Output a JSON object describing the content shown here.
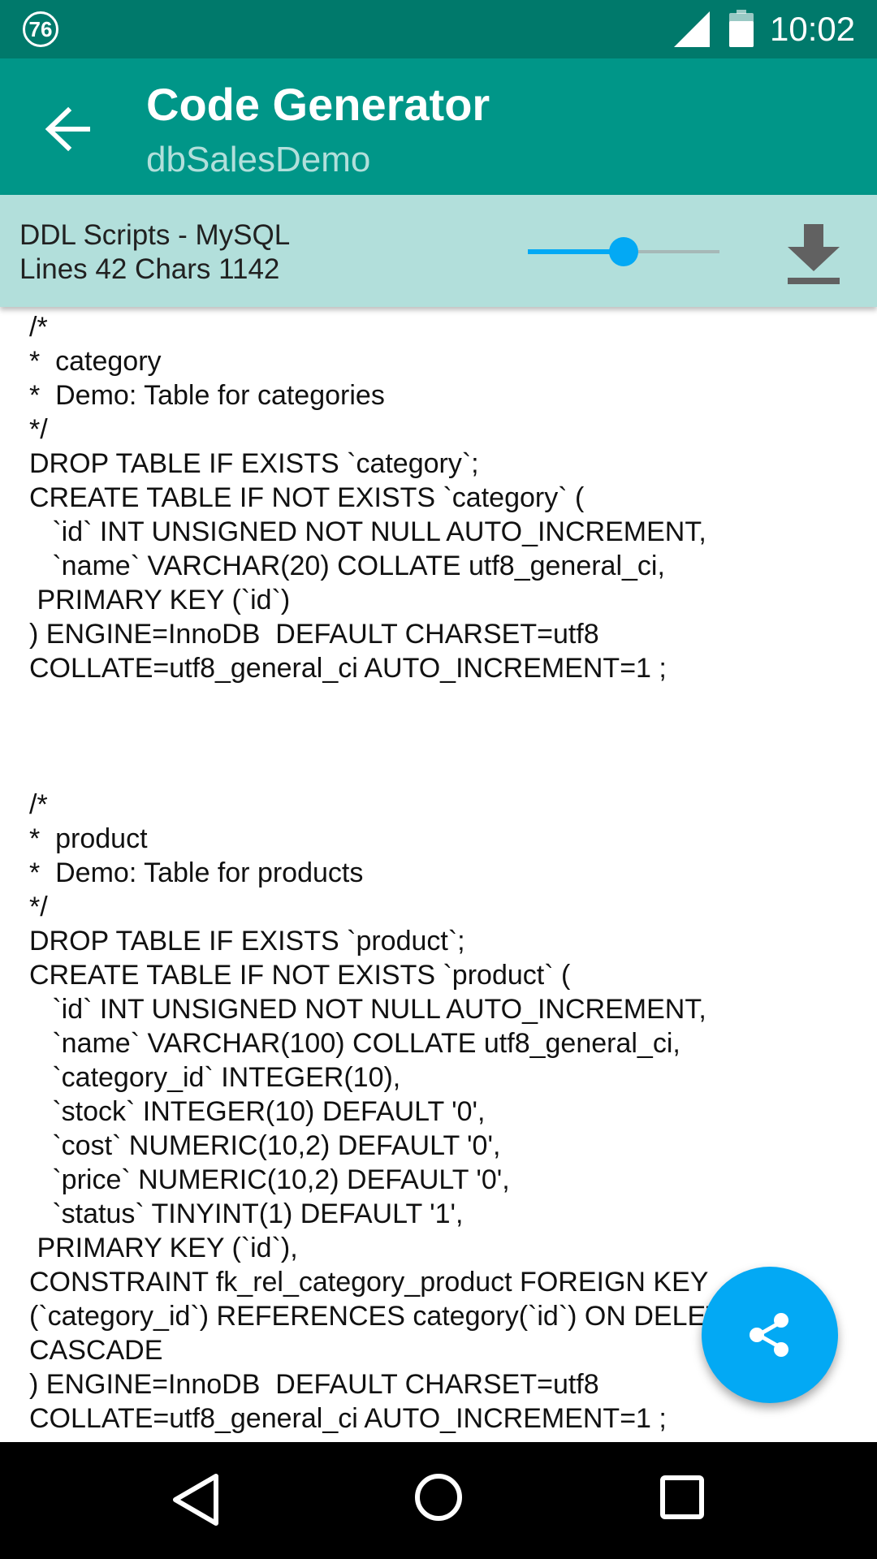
{
  "status_bar": {
    "notification_badge": "76",
    "time": "10:02",
    "icons": [
      "notification-badge-icon",
      "signal-icon",
      "battery-icon"
    ]
  },
  "app_bar": {
    "title": "Code Generator",
    "subtitle": "dbSalesDemo",
    "back_icon": "arrow-back-icon"
  },
  "toolbar": {
    "script_type": "DDL Scripts - MySQL",
    "stats": "Lines 42 Chars 1142",
    "zoom_level": 0.5,
    "download_icon": "download-icon"
  },
  "code": {
    "text": "/*\n*  category\n*  Demo: Table for categories\n*/\nDROP TABLE IF EXISTS `category`;\nCREATE TABLE IF NOT EXISTS `category` (\n   `id` INT UNSIGNED NOT NULL AUTO_INCREMENT,\n   `name` VARCHAR(20) COLLATE utf8_general_ci,\n PRIMARY KEY (`id`)\n) ENGINE=InnoDB  DEFAULT CHARSET=utf8\nCOLLATE=utf8_general_ci AUTO_INCREMENT=1 ;\n\n\n\n/*\n*  product\n*  Demo: Table for products\n*/\nDROP TABLE IF EXISTS `product`;\nCREATE TABLE IF NOT EXISTS `product` (\n   `id` INT UNSIGNED NOT NULL AUTO_INCREMENT,\n   `name` VARCHAR(100) COLLATE utf8_general_ci,\n   `category_id` INTEGER(10),\n   `stock` INTEGER(10) DEFAULT '0',\n   `cost` NUMERIC(10,2) DEFAULT '0',\n   `price` NUMERIC(10,2) DEFAULT '0',\n   `status` TINYINT(1) DEFAULT '1',\n PRIMARY KEY (`id`),\nCONSTRAINT fk_rel_category_product FOREIGN KEY\n(`category_id`) REFERENCES category(`id`) ON DELETE\nCASCADE\n) ENGINE=InnoDB  DEFAULT CHARSET=utf8\nCOLLATE=utf8_general_ci AUTO_INCREMENT=1 ;"
  },
  "fab": {
    "icon": "share-icon"
  },
  "nav_bar": {
    "icons": [
      "nav-back-icon",
      "nav-home-icon",
      "nav-recents-icon"
    ]
  },
  "colors": {
    "status_bar": "#00796B",
    "app_bar": "#009688",
    "toolbar": "#B2DFDB",
    "accent": "#03A9F4"
  }
}
